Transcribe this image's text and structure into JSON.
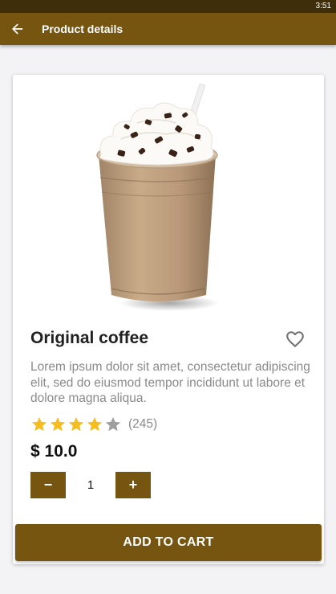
{
  "status_bar": {
    "time": "3:51"
  },
  "app_bar": {
    "title": "Product details",
    "back_icon": "arrow-back-icon"
  },
  "product": {
    "name": "Original coffee",
    "description": "Lorem ipsum dolor sit amet, consectetur adipiscing elit, sed do eiusmod tempor incididunt ut labore et dolore magna aliqua.",
    "rating": {
      "value": 4,
      "max": 5,
      "count_label": "(245)"
    },
    "price_label": "$ 10.0",
    "favorite_icon": "heart-outline-icon"
  },
  "quantity": {
    "value": "1",
    "decrement_symbol": "−",
    "increment_symbol": "+"
  },
  "actions": {
    "add_to_cart_label": "ADD TO CART"
  },
  "colors": {
    "primary": "#765511",
    "status_bar": "#3e2e09",
    "star_filled": "#f5bd1f",
    "star_empty": "#9e9e9e",
    "muted_text": "#8a8a8a"
  }
}
